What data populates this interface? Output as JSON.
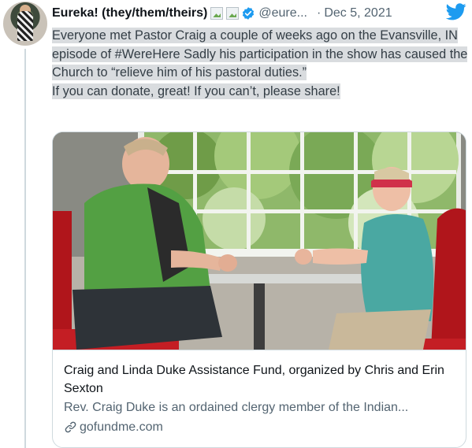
{
  "tweet": {
    "author_name": "Eureka! (they/them/theirs)",
    "handle": "@eure...",
    "separator": "·",
    "date": "Dec 5, 2021",
    "text_paragraph_1": "Everyone met Pastor Craig a couple of weeks ago on the Evansville, IN episode of #WereHere Sadly his participation in the show has caused the Church to “relieve him of his pastoral duties.”",
    "text_paragraph_2": "If you can donate, great! If you can’t, please share!"
  },
  "icons": {
    "avatar": "avatar",
    "inline_images": [
      "broken-image-icon",
      "broken-image-icon"
    ],
    "verified": "verified-badge-icon",
    "platform": "twitter-bird-icon",
    "link": "link-icon"
  },
  "card": {
    "image": "photo-two-people-seated-in-diner-booth",
    "title": "Craig and Linda Duke Assistance Fund, organized by Chris and Erin Sexton",
    "description": "Rev. Craig Duke is an ordained clergy member of the Indian...",
    "domain": "gofundme.com"
  },
  "colors": {
    "highlight": "#d9dcdf",
    "twitter_blue": "#1d9bf0",
    "secondary_text": "#536471",
    "border": "#cfd9de"
  }
}
